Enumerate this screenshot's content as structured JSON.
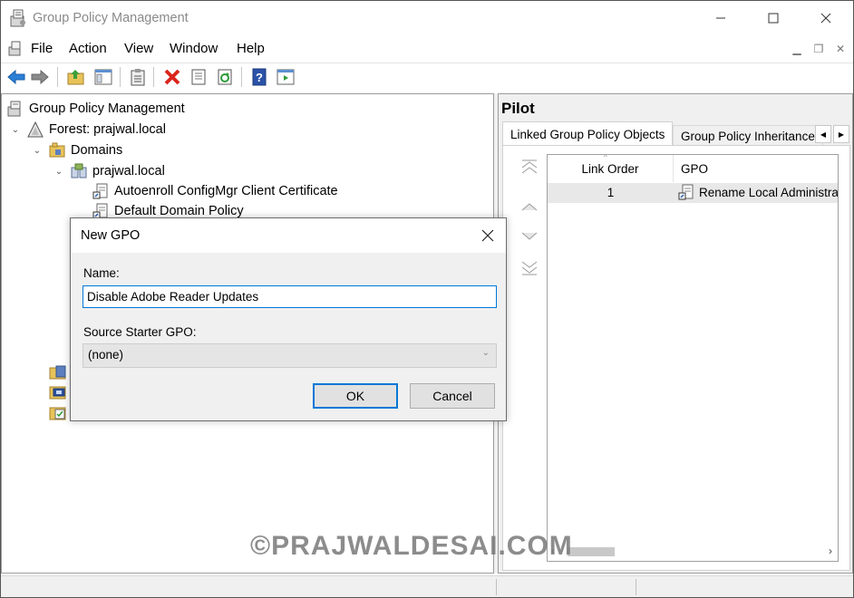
{
  "window": {
    "title": "Group Policy Management"
  },
  "menu": [
    "File",
    "Action",
    "View",
    "Window",
    "Help"
  ],
  "tree": {
    "root": "Group Policy Management",
    "forest": "Forest: prajwal.local",
    "domains": "Domains",
    "domain": "prajwal.local",
    "gpo1": "Autoenroll ConfigMgr Client Certificate",
    "gpo2": "Default Domain Policy"
  },
  "rightpane": {
    "title": "Pilot",
    "tab_active": "Linked Group Policy Objects",
    "tab_inactive": "Group Policy Inheritance",
    "col_link_order": "Link Order",
    "col_gpo": "GPO",
    "rows": [
      {
        "link_order": "1",
        "gpo": "Rename Local Administra"
      }
    ]
  },
  "dialog": {
    "title": "New GPO",
    "name_label": "Name:",
    "name_value": "Disable Adobe Reader Updates",
    "source_label": "Source Starter GPO:",
    "source_value": "(none)",
    "ok_label": "OK",
    "cancel_label": "Cancel"
  },
  "watermark": "©PRAJWALDESAI.COM",
  "colors": {
    "accent": "#0078d7",
    "delete_icon": "#d9261c"
  }
}
